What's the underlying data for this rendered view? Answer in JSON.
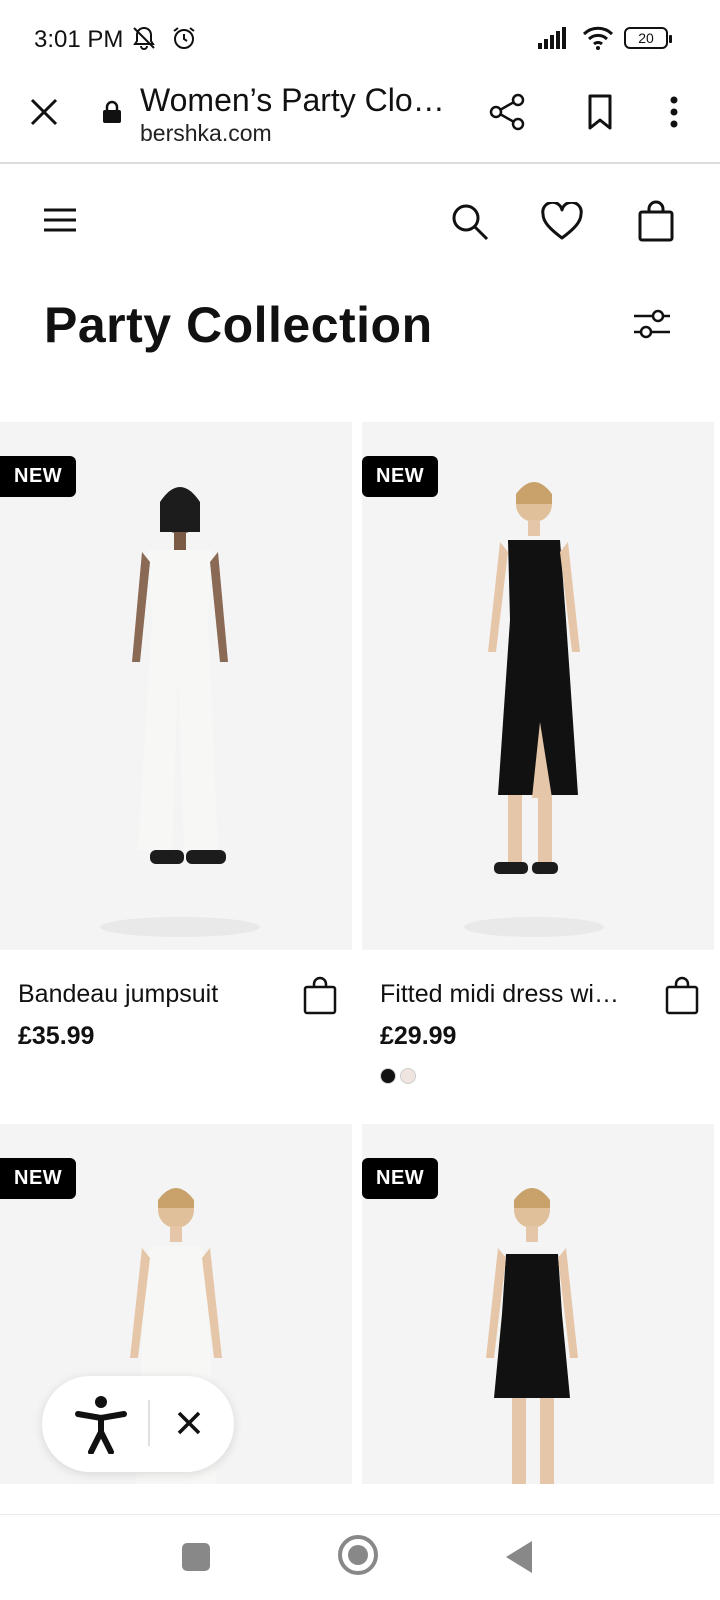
{
  "status_bar": {
    "time": "3:01 PM",
    "battery_level": "20",
    "icons": [
      "mute-icon",
      "alarm-icon",
      "signal-icon",
      "wifi-icon",
      "battery-icon"
    ]
  },
  "browser": {
    "page_title": "Women’s Party Clo…",
    "domain": "bershka.com",
    "icons": [
      "close-icon",
      "lock-icon",
      "share-icon",
      "bookmark-icon",
      "more-vert-icon"
    ]
  },
  "site_header": {
    "icons": [
      "menu-icon",
      "search-icon",
      "heart-icon",
      "bag-icon"
    ]
  },
  "collection": {
    "title": "Party Collection",
    "filter_icon": "sliders-icon"
  },
  "products": [
    {
      "badge": "NEW",
      "name": "Bandeau jumpsuit",
      "price": "£35.99",
      "garment_color": "#f7f7f5",
      "swatches": []
    },
    {
      "badge": "NEW",
      "name": "Fitted midi dress wi…",
      "price": "£29.99",
      "garment_color": "#111111",
      "swatches": [
        "#111111",
        "#efe4e0"
      ]
    },
    {
      "badge": "NEW",
      "name": "",
      "price": "",
      "garment_color": "#f7f7f5",
      "swatches": []
    },
    {
      "badge": "NEW",
      "name": "",
      "price": "",
      "garment_color": "#111111",
      "swatches": []
    }
  ],
  "accessibility_widget": {
    "icons": [
      "accessibility-person-icon",
      "close-icon"
    ]
  },
  "android_nav": {
    "icons": [
      "recents-square-icon",
      "home-circle-icon",
      "back-triangle-icon"
    ]
  },
  "colors": {
    "background": "#ffffff",
    "text": "#111111",
    "badge_bg": "#000000",
    "badge_text": "#ffffff",
    "image_bg": "#f4f4f4",
    "nav_icon": "#888888"
  }
}
